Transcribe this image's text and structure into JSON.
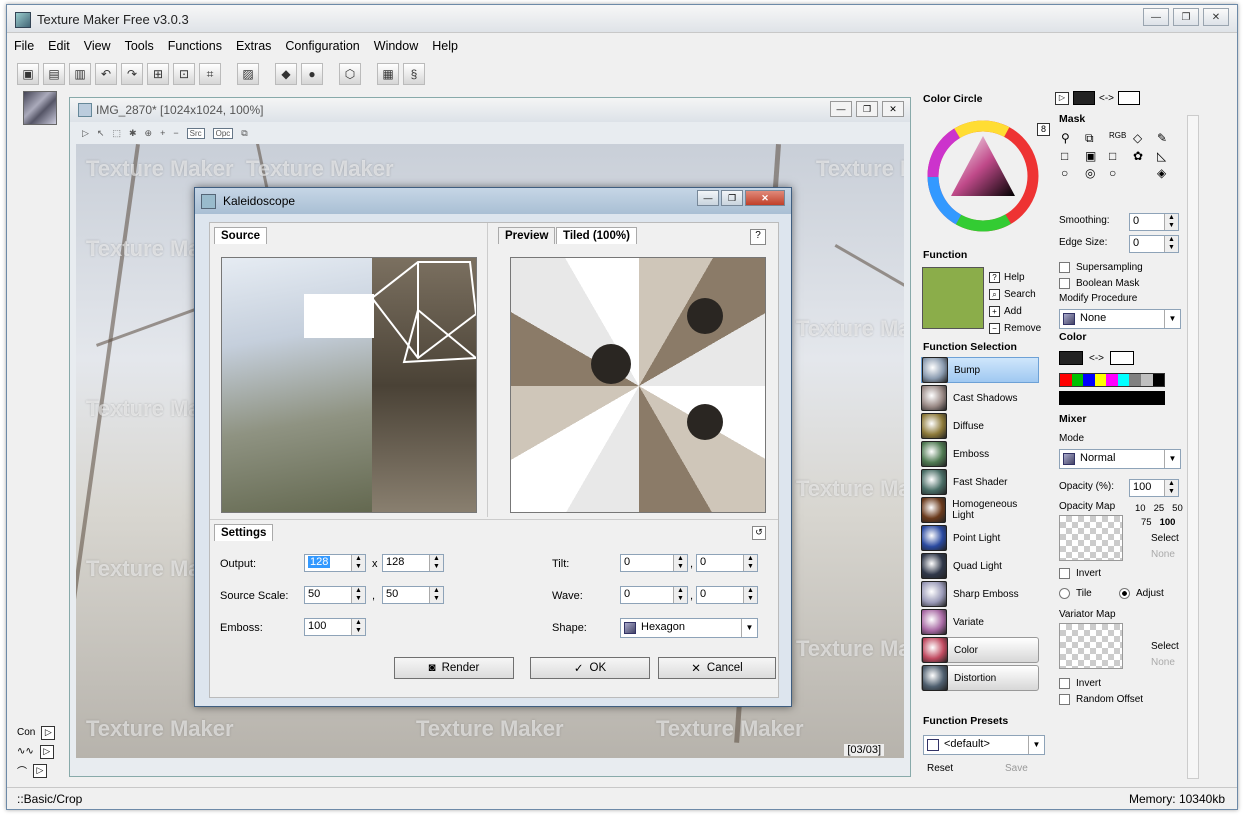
{
  "app": {
    "title": "Texture Maker Free v3.0.3"
  },
  "window_buttons": {
    "minimize": "—",
    "restore": "❐",
    "close": "✕"
  },
  "menu": [
    "File",
    "Edit",
    "View",
    "Tools",
    "Functions",
    "Extras",
    "Configuration",
    "Window",
    "Help"
  ],
  "image_window": {
    "title": "IMG_2870* [1024x1024, 100%]",
    "page_counter": "[03/03]",
    "src_label": "Src",
    "opc_label": "Opc"
  },
  "watermark": "Texture Maker",
  "left_buttons": [
    {
      "label": "Con"
    },
    {
      "label": "∿∿"
    },
    {
      "label": "⌒"
    }
  ],
  "status": {
    "left": "::Basic/Crop",
    "right": "Memory: 10340kb"
  },
  "dialog": {
    "title": "Kaleidoscope",
    "tabs": {
      "source": "Source",
      "preview": "Preview",
      "tiled": "Tiled (100%)",
      "settings": "Settings"
    },
    "help": "?",
    "settings": {
      "output_label": "Output:",
      "output_w": "128",
      "output_h": "128",
      "x_sep": "x",
      "source_scale_label": "Source Scale:",
      "source_scale_a": "50",
      "source_scale_b": "50",
      "emboss_label": "Emboss:",
      "emboss": "100",
      "tilt_label": "Tilt:",
      "tilt_a": "0",
      "tilt_b": "0",
      "wave_label": "Wave:",
      "wave_a": "0",
      "wave_b": "0",
      "shape_label": "Shape:",
      "shape": "Hexagon",
      "comma": ","
    },
    "buttons": {
      "render": "Render",
      "ok": "OK",
      "cancel": "Cancel"
    }
  },
  "color_circle": {
    "title": "Color Circle",
    "badge": "8"
  },
  "function_panel": {
    "title": "Function",
    "links": [
      "Help",
      "Search",
      "Add",
      "Remove"
    ]
  },
  "function_selection": {
    "title": "Function Selection",
    "items": [
      {
        "label": "Bump",
        "color": "#8a9bb0",
        "active": true
      },
      {
        "label": "Cast Shadows",
        "color": "#9a8a86"
      },
      {
        "label": "Diffuse",
        "color": "#8d7a3a"
      },
      {
        "label": "Emboss",
        "color": "#4f7a52"
      },
      {
        "label": "Fast Shader",
        "color": "#4a6e66"
      },
      {
        "label": "Homogeneous Light",
        "color": "#6a3a1c"
      },
      {
        "label": "Point Light",
        "color": "#2a4aa0"
      },
      {
        "label": "Quad Light",
        "color": "#30384a"
      },
      {
        "label": "Sharp Emboss",
        "color": "#9a9ab8"
      },
      {
        "label": "Variate",
        "color": "#a86aa4"
      },
      {
        "label": "Color",
        "color": "#c04a60",
        "category": true
      },
      {
        "label": "Distortion",
        "color": "#506070",
        "category": true
      }
    ]
  },
  "function_presets": {
    "title": "Function Presets",
    "value": "<default>",
    "reset": "Reset",
    "save": "Save"
  },
  "mask": {
    "title": "Mask",
    "rgb_label": "RGB",
    "smoothing_label": "Smoothing:",
    "smoothing": "0",
    "edge_label": "Edge Size:",
    "edge": "0",
    "supersampling": "Supersampling",
    "boolean": "Boolean Mask",
    "modify_label": "Modify Procedure",
    "modify": "None"
  },
  "swap_label": "<->",
  "color_panel": {
    "title": "Color",
    "swatches": [
      "#ff0000",
      "#00c000",
      "#0000ff",
      "#ffff00",
      "#ff00ff",
      "#00ffff",
      "#808080",
      "#c0c0c0",
      "#000000"
    ]
  },
  "mixer": {
    "title": "Mixer",
    "mode_label": "Mode",
    "mode": "Normal",
    "opacity_label": "Opacity (%):",
    "opacity": "100",
    "opacity_map_label": "Opacity Map",
    "presets_row1": [
      "10",
      "25",
      "50"
    ],
    "presets_row2": [
      "75",
      "100"
    ],
    "select": "Select",
    "none": "None",
    "invert": "Invert",
    "tile": "Tile",
    "adjust": "Adjust",
    "variator_label": "Variator Map",
    "random_offset": "Random Offset"
  }
}
